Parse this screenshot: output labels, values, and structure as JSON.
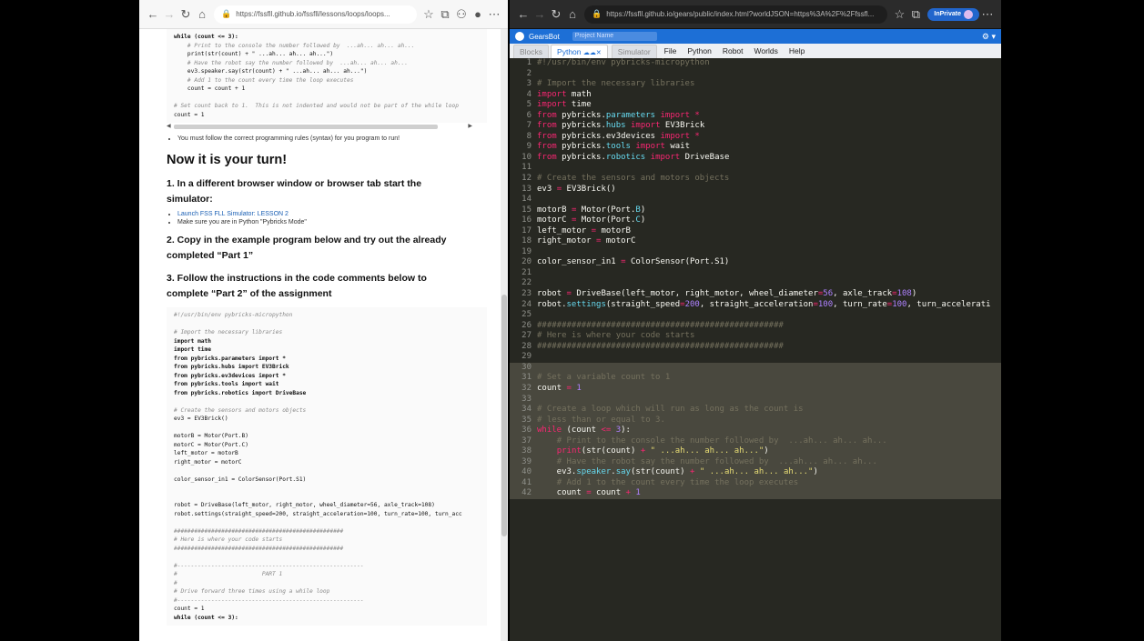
{
  "left_browser": {
    "url": "https://fssfll.github.io/fssfll/lessons/loops/loops...",
    "top_code": [
      {
        "t": "while (count <= 3):",
        "c": "kw"
      },
      {
        "t": "    # Print to the console the number followed by  ...ah... ah... ah...",
        "c": "cm"
      },
      {
        "t": "    print(str(count) + \" ...ah... ah... ah...\")",
        "c": ""
      },
      {
        "t": "    # Have the robot say the number followed by  ...ah... ah... ah...",
        "c": "cm"
      },
      {
        "t": "    ev3.speaker.say(str(count) + \" ...ah... ah... ah...\")",
        "c": ""
      },
      {
        "t": "    # Add 1 to the count every time the loop executes",
        "c": "cm"
      },
      {
        "t": "    count = count + 1",
        "c": ""
      },
      {
        "t": "",
        "c": ""
      },
      {
        "t": "# Set count back to 1.  This is not indented and would not be part of the while loop",
        "c": "cm"
      },
      {
        "t": "count = 1",
        "c": ""
      }
    ],
    "syntax_note": "You must follow the correct programming rules (syntax) for you program to run!",
    "heading": "Now it is your turn!",
    "step1": "1. In a different browser window or browser tab start the simulator:",
    "step1_link": "Launch FSS FLL Simulator: LESSON 2",
    "step1_note": "Make sure you are in Python \"Pybricks Mode\"",
    "step2": "2. Copy in the example program below and try out the already completed “Part 1”",
    "step3": "3. Follow the instructions in the code comments below to complete “Part 2” of the assignment",
    "bottom_code": [
      {
        "t": "#!/usr/bin/env pybricks-micropython",
        "c": "cm"
      },
      {
        "t": "",
        "c": ""
      },
      {
        "t": "# Import the necessary libraries",
        "c": "cm"
      },
      {
        "t": "import math",
        "c": "kw"
      },
      {
        "t": "import time",
        "c": "kw"
      },
      {
        "t": "from pybricks.parameters import *",
        "c": "kw"
      },
      {
        "t": "from pybricks.hubs import EV3Brick",
        "c": "kw"
      },
      {
        "t": "from pybricks.ev3devices import *",
        "c": "kw"
      },
      {
        "t": "from pybricks.tools import wait",
        "c": "kw"
      },
      {
        "t": "from pybricks.robotics import DriveBase",
        "c": "kw"
      },
      {
        "t": "",
        "c": ""
      },
      {
        "t": "# Create the sensors and motors objects",
        "c": "cm"
      },
      {
        "t": "ev3 = EV3Brick()",
        "c": ""
      },
      {
        "t": "",
        "c": ""
      },
      {
        "t": "motorB = Motor(Port.B)",
        "c": ""
      },
      {
        "t": "motorC = Motor(Port.C)",
        "c": ""
      },
      {
        "t": "left_motor = motorB",
        "c": ""
      },
      {
        "t": "right_motor = motorC",
        "c": ""
      },
      {
        "t": "",
        "c": ""
      },
      {
        "t": "color_sensor_in1 = ColorSensor(Port.S1)",
        "c": ""
      },
      {
        "t": "",
        "c": ""
      },
      {
        "t": "",
        "c": ""
      },
      {
        "t": "robot = DriveBase(left_motor, right_motor, wheel_diameter=56, axle_track=108)",
        "c": ""
      },
      {
        "t": "robot.settings(straight_speed=200, straight_acceleration=100, turn_rate=100, turn_acc",
        "c": ""
      },
      {
        "t": "",
        "c": ""
      },
      {
        "t": "##################################################",
        "c": "cm"
      },
      {
        "t": "# Here is where your code starts",
        "c": "cm"
      },
      {
        "t": "##################################################",
        "c": "cm"
      },
      {
        "t": "",
        "c": ""
      },
      {
        "t": "#-------------------------------------------------------",
        "c": "cm"
      },
      {
        "t": "#                         PART 1",
        "c": "cm"
      },
      {
        "t": "#",
        "c": "cm"
      },
      {
        "t": "# Drive forward three times using a while loop",
        "c": "cm"
      },
      {
        "t": "#-------------------------------------------------------",
        "c": "cm"
      },
      {
        "t": "count = 1",
        "c": ""
      },
      {
        "t": "while (count <= 3):",
        "c": "kw"
      }
    ]
  },
  "right_browser": {
    "url": "https://fssfll.github.io/gears/public/index.html?worldJSON=https%3A%2F%2Ffssfl...",
    "inprivate": "InPrivate",
    "app_name": "GearsBot",
    "project_placeholder": "Project Name",
    "tabs": [
      "Blocks",
      "Python",
      "Simulator"
    ],
    "menu": [
      "File",
      "Python",
      "Robot",
      "Worlds",
      "Help"
    ]
  },
  "editor": {
    "line_numbers": [
      "1",
      "2",
      "3",
      "4",
      "5",
      "6",
      "7",
      "8",
      "9",
      "10",
      "11",
      "12",
      "13",
      "14",
      "15",
      "16",
      "17",
      "18",
      "19",
      "20",
      "21",
      "22",
      "23",
      "24",
      "25",
      "26",
      "27",
      "28",
      "29",
      "30",
      "31",
      "32",
      "33",
      "34",
      "35",
      "36",
      "37",
      "38",
      "39",
      "40",
      "41",
      "42"
    ],
    "highlight_from": 30,
    "lines": [
      [
        [
          "cm",
          "#!/usr/bin/env pybricks-micropython"
        ]
      ],
      [],
      [
        [
          "cm",
          "# Import the necessary libraries"
        ]
      ],
      [
        [
          "kw",
          "import"
        ],
        [
          "txt",
          " math"
        ]
      ],
      [
        [
          "kw",
          "import"
        ],
        [
          "txt",
          " time"
        ]
      ],
      [
        [
          "kw",
          "from"
        ],
        [
          "txt",
          " pybricks."
        ],
        [
          "mod",
          "parameters"
        ],
        [
          "txt",
          " "
        ],
        [
          "kw",
          "import"
        ],
        [
          "op",
          " *"
        ]
      ],
      [
        [
          "kw",
          "from"
        ],
        [
          "txt",
          " pybricks."
        ],
        [
          "mod",
          "hubs"
        ],
        [
          "txt",
          " "
        ],
        [
          "kw",
          "import"
        ],
        [
          "txt",
          " EV3Brick"
        ]
      ],
      [
        [
          "kw",
          "from"
        ],
        [
          "txt",
          " pybricks."
        ],
        [
          "txt",
          "ev3devices"
        ],
        [
          "txt",
          " "
        ],
        [
          "kw",
          "import"
        ],
        [
          "op",
          " *"
        ]
      ],
      [
        [
          "kw",
          "from"
        ],
        [
          "txt",
          " pybricks."
        ],
        [
          "mod",
          "tools"
        ],
        [
          "txt",
          " "
        ],
        [
          "kw",
          "import"
        ],
        [
          "txt",
          " wait"
        ]
      ],
      [
        [
          "kw",
          "from"
        ],
        [
          "txt",
          " pybricks."
        ],
        [
          "mod",
          "robotics"
        ],
        [
          "txt",
          " "
        ],
        [
          "kw",
          "import"
        ],
        [
          "txt",
          " DriveBase"
        ]
      ],
      [],
      [
        [
          "cm",
          "# Create the sensors and motors objects"
        ]
      ],
      [
        [
          "txt",
          "ev3 "
        ],
        [
          "op",
          "="
        ],
        [
          "txt",
          " EV3Brick()"
        ]
      ],
      [],
      [
        [
          "txt",
          "motorB "
        ],
        [
          "op",
          "="
        ],
        [
          "txt",
          " Motor(Port."
        ],
        [
          "mod",
          "B"
        ],
        [
          "txt",
          ")"
        ]
      ],
      [
        [
          "txt",
          "motorC "
        ],
        [
          "op",
          "="
        ],
        [
          "txt",
          " Motor(Port."
        ],
        [
          "mod",
          "C"
        ],
        [
          "txt",
          ")"
        ]
      ],
      [
        [
          "txt",
          "left_motor "
        ],
        [
          "op",
          "="
        ],
        [
          "txt",
          " motorB"
        ]
      ],
      [
        [
          "txt",
          "right_motor "
        ],
        [
          "op",
          "="
        ],
        [
          "txt",
          " motorC"
        ]
      ],
      [],
      [
        [
          "txt",
          "color_sensor_in1 "
        ],
        [
          "op",
          "="
        ],
        [
          "txt",
          " ColorSensor(Port.S1)"
        ]
      ],
      [],
      [],
      [
        [
          "txt",
          "robot "
        ],
        [
          "op",
          "="
        ],
        [
          "txt",
          " DriveBase(left_motor, right_motor, wheel_diameter"
        ],
        [
          "op",
          "="
        ],
        [
          "num",
          "56"
        ],
        [
          "txt",
          ", axle_track"
        ],
        [
          "op",
          "="
        ],
        [
          "num",
          "108"
        ],
        [
          "txt",
          ")"
        ]
      ],
      [
        [
          "txt",
          "robot."
        ],
        [
          "mod",
          "settings"
        ],
        [
          "txt",
          "(straight_speed"
        ],
        [
          "op",
          "="
        ],
        [
          "num",
          "200"
        ],
        [
          "txt",
          ", straight_acceleration"
        ],
        [
          "op",
          "="
        ],
        [
          "num",
          "100"
        ],
        [
          "txt",
          ", turn_rate"
        ],
        [
          "op",
          "="
        ],
        [
          "num",
          "100"
        ],
        [
          "txt",
          ", turn_accelerati"
        ]
      ],
      [],
      [
        [
          "cm",
          "##################################################"
        ]
      ],
      [
        [
          "cm",
          "# Here is where your code starts"
        ]
      ],
      [
        [
          "cm",
          "##################################################"
        ]
      ],
      [],
      [
        [
          "txt",
          ""
        ]
      ],
      [
        [
          "cm",
          "# Set a variable count to 1"
        ]
      ],
      [
        [
          "txt",
          "count "
        ],
        [
          "op",
          "="
        ],
        [
          "num",
          " 1"
        ]
      ],
      [],
      [
        [
          "cm",
          "# Create a loop which will run as long as the count is"
        ]
      ],
      [
        [
          "cm",
          "# less than or equal to 3."
        ]
      ],
      [
        [
          "kw",
          "while"
        ],
        [
          "txt",
          " (count "
        ],
        [
          "op",
          "<="
        ],
        [
          "num",
          " 3"
        ],
        [
          "txt",
          "):"
        ]
      ],
      [
        [
          "txt",
          "    "
        ],
        [
          "cm",
          "# Print to the console the number followed by  ...ah... ah... ah..."
        ]
      ],
      [
        [
          "txt",
          "    "
        ],
        [
          "kw",
          "print"
        ],
        [
          "txt",
          "(str(count) "
        ],
        [
          "op",
          "+"
        ],
        [
          "str",
          " \" ...ah... ah... ah...\""
        ],
        [
          "txt",
          ")"
        ]
      ],
      [
        [
          "txt",
          "    "
        ],
        [
          "cm",
          "# Have the robot say the number followed by  ...ah... ah... ah..."
        ]
      ],
      [
        [
          "txt",
          "    ev3."
        ],
        [
          "mod",
          "speaker"
        ],
        [
          "txt",
          "."
        ],
        [
          "mod",
          "say"
        ],
        [
          "txt",
          "(str(count) "
        ],
        [
          "op",
          "+"
        ],
        [
          "str",
          " \" ...ah... ah... ah...\""
        ],
        [
          "txt",
          ")"
        ]
      ],
      [
        [
          "txt",
          "    "
        ],
        [
          "cm",
          "# Add 1 to the count every time the loop executes"
        ]
      ],
      [
        [
          "txt",
          "    count "
        ],
        [
          "op",
          "="
        ],
        [
          "txt",
          " count "
        ],
        [
          "op",
          "+"
        ],
        [
          "num",
          " 1"
        ]
      ]
    ]
  }
}
